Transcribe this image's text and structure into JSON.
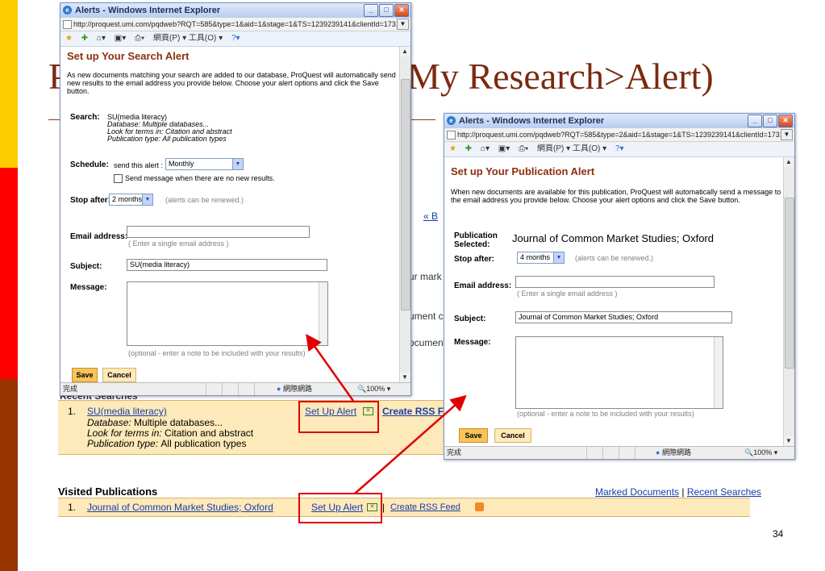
{
  "slide": {
    "title_left": "P",
    "title_right": "My Research>Alert)",
    "page_number": "34"
  },
  "colors": {
    "bar_yellow": "#ffcc00",
    "bar_red": "#ff0000",
    "bar_brown": "#993300",
    "alert_heading": "#8b2f10",
    "red_highlight": "#e00000",
    "orange_row": "#fde9b9"
  },
  "background_page": {
    "back_link_fragment": "« B",
    "fragment_1": "ur mark",
    "fragment_2": "ument c",
    "fragment_3": "ocument",
    "recent_searches_header": "Recent Searches",
    "recent_row": {
      "index": "1.",
      "link": "SU(media literacy)",
      "database_label": "Database:",
      "database_value": "Multiple databases...",
      "terms_label": "Look for terms in:",
      "terms_value": "Citation and abstract",
      "pubtype_label": "Publication type:",
      "pubtype_value": "All publication types",
      "set_up_alert": "Set Up Alert",
      "create_rss": "Create RSS Fee"
    },
    "visited_header": "Visited Publications",
    "marked_documents": "Marked Documents",
    "separator": "|",
    "recent_searches_link": "Recent Searches",
    "visited_row": {
      "index": "1.",
      "link": "Journal of Common Market Studies; Oxford",
      "set_up_alert": "Set Up Alert",
      "separator": "|",
      "create_rss": "Create RSS Feed"
    }
  },
  "search_alert_window": {
    "title": "Alerts - Windows Internet Explorer",
    "url": "http://proquest.umi.com/pqdweb?RQT=585&type=1&aid=1&stage=1&TS=1239239141&clientId=17319",
    "toolbar_text": "網頁(P) ▾   工具(O) ▾",
    "heading": "Set up Your Search Alert",
    "intro": "As new documents matching your search are added to our database, ProQuest will automatically send new results to the email address you provide below. Choose your alert options and click the Save button.",
    "search_label": "Search:",
    "search_value": "SU(media literacy)",
    "search_db": "Database: Multiple databases...",
    "search_terms": "Look for terms in: Citation and abstract",
    "search_pubtype": "Publication type: All publication types",
    "schedule_label": "Schedule:",
    "schedule_text": "send this alert :",
    "schedule_value": "Monthly",
    "no_results_checkbox": "Send message when there are no new results.",
    "stop_after_label": "Stop after:",
    "stop_after_value": "2 months",
    "stop_after_hint": "(alerts can be renewed.)",
    "email_label": "Email address:",
    "email_value": "",
    "email_hint": "( Enter a single email address )",
    "subject_label": "Subject:",
    "subject_value": "SU(media literacy)",
    "message_label": "Message:",
    "message_hint": "(optional - enter a note to be included with your results)",
    "save_label": "Save",
    "cancel_label": "Cancel",
    "status_done": "完成",
    "status_zone": "網際網路",
    "status_zoom": "100%"
  },
  "publication_alert_window": {
    "title": "Alerts - Windows Internet Explorer",
    "url": "http://proquest.umi.com/pqdweb?RQT=585&type=2&aid=1&stage=1&TS=1239239141&clientId=17319",
    "toolbar_text": "網頁(P) ▾   工具(O) ▾",
    "heading": "Set up Your Publication Alert",
    "intro": "When new documents are available for this publication, ProQuest will automatically send a message to the email address you provide below. Choose your alert options and click the Save button.",
    "pub_label": "Publication Selected:",
    "pub_value": "Journal of Common Market Studies; Oxford",
    "stop_after_label": "Stop after:",
    "stop_after_value": "4 months",
    "stop_after_hint": "(alerts can be renewed.)",
    "email_label": "Email address:",
    "email_value": "",
    "email_hint": "( Enter a single email address )",
    "subject_label": "Subject:",
    "subject_value": "Journal of Common Market Studies; Oxford",
    "message_label": "Message:",
    "message_hint": "(optional - enter a note to be included with your results)",
    "save_label": "Save",
    "cancel_label": "Cancel",
    "status_done": "完成",
    "status_zone": "網際網路",
    "status_zoom": "100%"
  }
}
